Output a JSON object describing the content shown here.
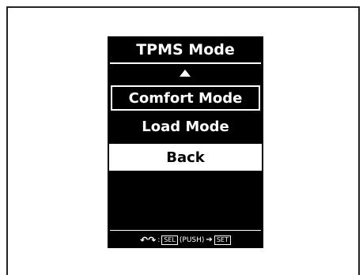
{
  "screen": {
    "title": "TPMS Mode",
    "items": [
      {
        "label": "Comfort Mode",
        "state": "focused"
      },
      {
        "label": "Load Mode",
        "state": "normal"
      },
      {
        "label": "Back",
        "state": "selected"
      }
    ],
    "scroll_up_icon": "up-triangle-icon",
    "footer": {
      "rotate_icon": "rotate-knob-icon",
      "rotate_glyph": "↶↷",
      "colon": ":",
      "sel": "SEL",
      "push": "(PUSH)",
      "arrow_glyph": "➔",
      "set": "SET"
    }
  },
  "colors": {
    "screen_bg": "#000000",
    "text": "#ffffff",
    "highlight_bg": "#ffffff",
    "highlight_text": "#000000"
  }
}
